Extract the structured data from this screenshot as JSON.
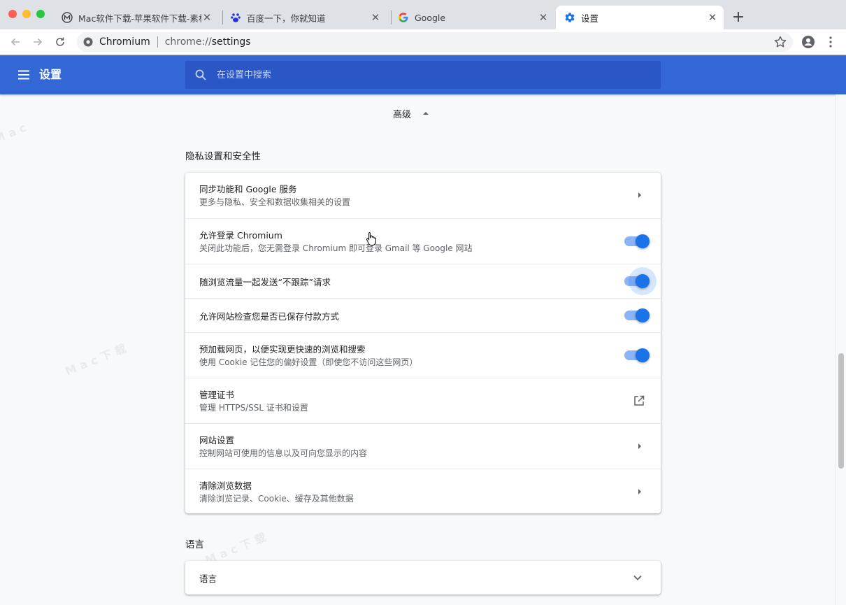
{
  "window": {
    "tabs": [
      {
        "title": "Mac软件下载-苹果软件下载-素材",
        "favicon": "macdown-m-icon",
        "active": false
      },
      {
        "title": "百度一下，你就知道",
        "favicon": "baidu-paw-icon",
        "active": false
      },
      {
        "title": "Google",
        "favicon": "google-g-icon",
        "active": false
      },
      {
        "title": "设置",
        "favicon": "gear-icon",
        "active": true
      }
    ],
    "close_glyph": "✕",
    "new_tab_glyph": "+"
  },
  "omnibox": {
    "origin": "Chromium",
    "scheme": "chrome://",
    "path": "settings"
  },
  "header": {
    "title": "设置",
    "search_placeholder": "在设置中搜索"
  },
  "advanced": {
    "label": "高级",
    "expanded": true
  },
  "privacy": {
    "title": "隐私设置和安全性",
    "rows": [
      {
        "label": "同步功能和 Google 服务",
        "sub": "更多与隐私、安全和数据收集相关的设置",
        "control": "arrow"
      },
      {
        "label": "允许登录 Chromium",
        "sub": "关闭此功能后，您无需登录 Chromium 即可登录 Gmail 等 Google 网站",
        "control": "toggle",
        "on": true
      },
      {
        "label": "随浏览流量一起发送“不跟踪”请求",
        "sub": "",
        "control": "toggle",
        "on": true,
        "focused": true
      },
      {
        "label": "允许网站检查您是否已保存付款方式",
        "sub": "",
        "control": "toggle",
        "on": true
      },
      {
        "label": "预加载网页，以便实现更快速的浏览和搜索",
        "sub": "使用 Cookie 记住您的偏好设置（即使您不访问这些网页）",
        "control": "toggle",
        "on": true
      },
      {
        "label": "管理证书",
        "sub": "管理 HTTPS/SSL 证书和设置",
        "control": "external"
      },
      {
        "label": "网站设置",
        "sub": "控制网站可使用的信息以及可向您显示的内容",
        "control": "arrow"
      },
      {
        "label": "清除浏览数据",
        "sub": "清除浏览记录、Cookie、缓存及其他数据",
        "control": "arrow"
      }
    ]
  },
  "languages": {
    "title": "语言",
    "row_label": "语言"
  },
  "colors": {
    "header_blue": "#3367d6",
    "search_blue": "#2a56c6",
    "toggle_knob": "#1a73e8",
    "toggle_track": "#8ab4f8"
  }
}
